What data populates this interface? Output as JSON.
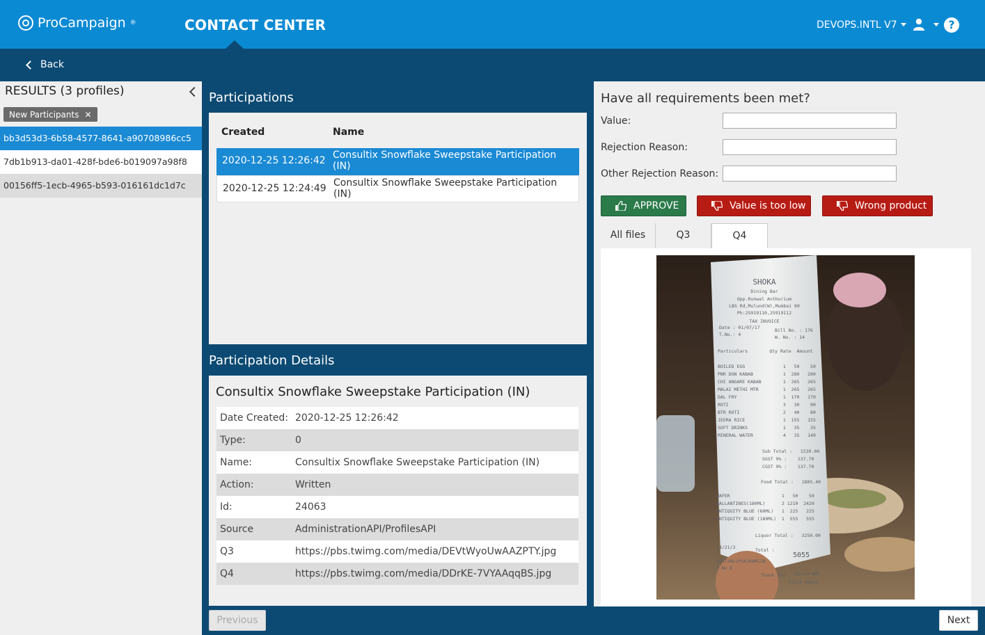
{
  "topbar": {
    "brand": "ProCampaign",
    "brand_mark": "®",
    "app_title": "CONTACT CENTER",
    "environment": "DEVOPS.INTL V7",
    "help_glyph": "?"
  },
  "subbar": {
    "back_label": "Back"
  },
  "sidebar": {
    "title": "RESULTS (3 profiles)",
    "filter_chip": "New Participants",
    "filter_chip_close": "✕",
    "profiles": [
      "bb3d53d3-6b58-4577-8641-a90708986cc5",
      "7db1b913-da01-428f-bde6-b019097a98f8",
      "00156ff5-1ecb-4965-b593-016161dc1d7c"
    ]
  },
  "participations": {
    "heading": "Participations",
    "columns": [
      "Created",
      "Name"
    ],
    "rows": [
      {
        "created": "2020-12-25 12:26:42",
        "name": "Consultix Snowflake Sweepstake Participation (IN)"
      },
      {
        "created": "2020-12-25 12:24:49",
        "name": "Consultix Snowflake Sweepstake Participation (IN)"
      }
    ]
  },
  "details": {
    "heading": "Participation Details",
    "title": "Consultix Snowflake Sweepstake Participation (IN)",
    "rows": [
      {
        "key": "Date Created:",
        "value": "2020-12-25 12:26:42"
      },
      {
        "key": "Type:",
        "value": "0"
      },
      {
        "key": "Name:",
        "value": "Consultix Snowflake Sweepstake Participation (IN)"
      },
      {
        "key": "Action:",
        "value": "Written"
      },
      {
        "key": "Id:",
        "value": "24063"
      },
      {
        "key": "Source",
        "value": "AdministrationAPI/ProfilesAPI"
      },
      {
        "key": "Q3",
        "value": "https://pbs.twimg.com/media/DEVtWyoUwAAZPTY.jpg"
      },
      {
        "key": "Q4",
        "value": "https://pbs.twimg.com/media/DDrKE-7VYAAqqBS.jpg"
      }
    ]
  },
  "review": {
    "question": "Have all requirements been met?",
    "fields": [
      {
        "label": "Value:",
        "value": ""
      },
      {
        "label": "Rejection Reason:",
        "value": ""
      },
      {
        "label": "Other Rejection Reason:",
        "value": ""
      }
    ],
    "buttons": {
      "approve": "APPROVE",
      "value_too_low": "Value is too low",
      "wrong_product": "Wrong product"
    },
    "tabs": [
      "All files",
      "Q3",
      "Q4"
    ],
    "active_tab": "Q4"
  },
  "receipt": {
    "restaurant": "SHOKA",
    "subtitle": "Dining Bar",
    "address": [
      "Opp.Runwal Anthurium",
      "LBS Rd,Mulund(W),Mumbai 80",
      "Ph:25919110,25919112"
    ],
    "doc_type": "TAX INVOICE",
    "header_left": [
      "Date : 01/07/17",
      "T.No.: 4"
    ],
    "header_right": [
      "Bill No. : 176",
      "W. No. : 14"
    ],
    "columns": "Particulars        Qty Rate  Amount",
    "items": [
      "BOILED EGG              1   50    50",
      "PNR DON KABAB           1  280   280",
      "CHI ANGARE KABAB        1  265   265",
      "MALAI METHI MTR         1  265   265",
      "DAL FRY                 1  170   170",
      "ROTI                    3   30    90",
      "BTR ROTI                2   40    80",
      "JEERA RICE              1  155   155",
      "SOFT DRINKS             1   35    35",
      "MINERAL WATER           4   35   140"
    ],
    "subtotals": [
      "Sub Total :   1530.00",
      "SGST 9% :    137.70",
      "CGST 9% :    137.70"
    ],
    "food_total": "Food Total :   1805.40",
    "liquor_items": [
      "WAFER                   1   50    50",
      "BALLANTINES(180ML)      2 1210  2420",
      "ANTIQUITY BLUE (60ML)   1  225   225",
      "ANTIQUITY BLUE (180ML)  1  555   555"
    ],
    "liquor_total": "Liquor Total :   3250.00",
    "date_line": "14/21/3",
    "total_label": "Total :",
    "total_value": "5055",
    "footer": [
      "SGST4ALLPSA10AMIZN",
      "T.No.E",
      "Thank You",
      "(01:14 AM)",
      "Visit Again"
    ]
  },
  "nav": {
    "previous": "Previous",
    "next": "Next"
  },
  "colors": {
    "topbar": "#0b8ad4",
    "subbar": "#0c4a73",
    "selected_row": "#1a8ad4",
    "approve": "#2a7a4a",
    "reject": "#b71c14"
  }
}
